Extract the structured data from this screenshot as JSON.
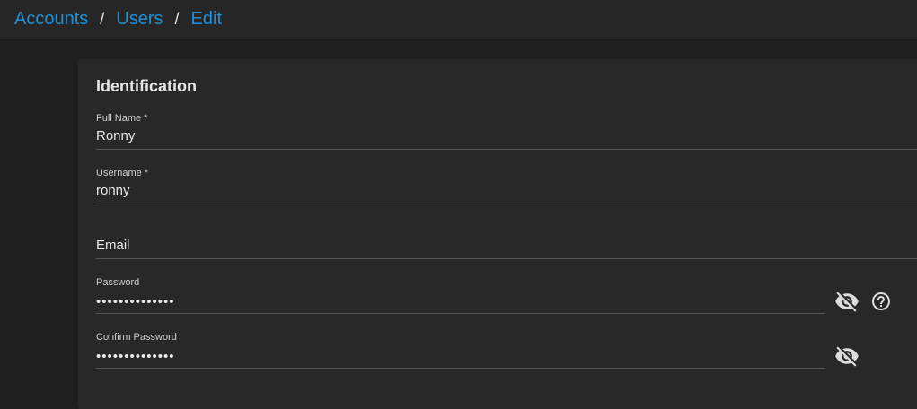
{
  "breadcrumb": {
    "items": [
      "Accounts",
      "Users",
      "Edit"
    ],
    "separator": "/"
  },
  "section": {
    "title": "Identification"
  },
  "fields": {
    "full_name": {
      "label": "Full Name *",
      "value": "Ronny"
    },
    "username": {
      "label": "Username *",
      "value": "ronny"
    },
    "email": {
      "placeholder": "Email",
      "value": ""
    },
    "password": {
      "label": "Password",
      "value": "••••••••••••••"
    },
    "confirm_password": {
      "label": "Confirm Password",
      "value": "••••••••••••••"
    }
  },
  "icons": {
    "visibility_toggle": "eye-off-icon",
    "help": "help-circle-icon"
  },
  "colors": {
    "accent": "#1e90d6",
    "background": "#1f1f1f",
    "card": "#282828"
  }
}
